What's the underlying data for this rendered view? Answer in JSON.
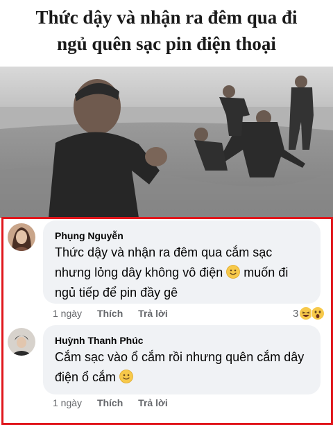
{
  "meme": {
    "caption_line1": "Thức dậy và nhận ra đêm qua đi",
    "caption_line2": "ngủ quên sạc pin điện thoại"
  },
  "comments": [
    {
      "author": "Phụng Nguyễn",
      "text_part1": "Thức dậy và nhận ra đêm qua cắm sạc nhưng lỏng dây không vô điện",
      "emoji": "slightly-smiling-face",
      "text_part2": "muốn đi ngủ tiếp để pin đầy gê",
      "time": "1 ngày",
      "like_label": "Thích",
      "reply_label": "Trả lời",
      "reaction_count": "3",
      "reactions": [
        "haha",
        "wow"
      ]
    },
    {
      "author": "Huỳnh Thanh Phúc",
      "text_part1": "Cắm sạc vào ổ cắm rồi nhưng quên cắm dây điện ổ cắm",
      "emoji": "slightly-smiling-face",
      "time": "1 ngày",
      "like_label": "Thích",
      "reply_label": "Trả lời"
    }
  ],
  "colors": {
    "highlight_border": "#e0161c",
    "bubble": "#f0f2f5",
    "muted_text": "#65676b"
  }
}
